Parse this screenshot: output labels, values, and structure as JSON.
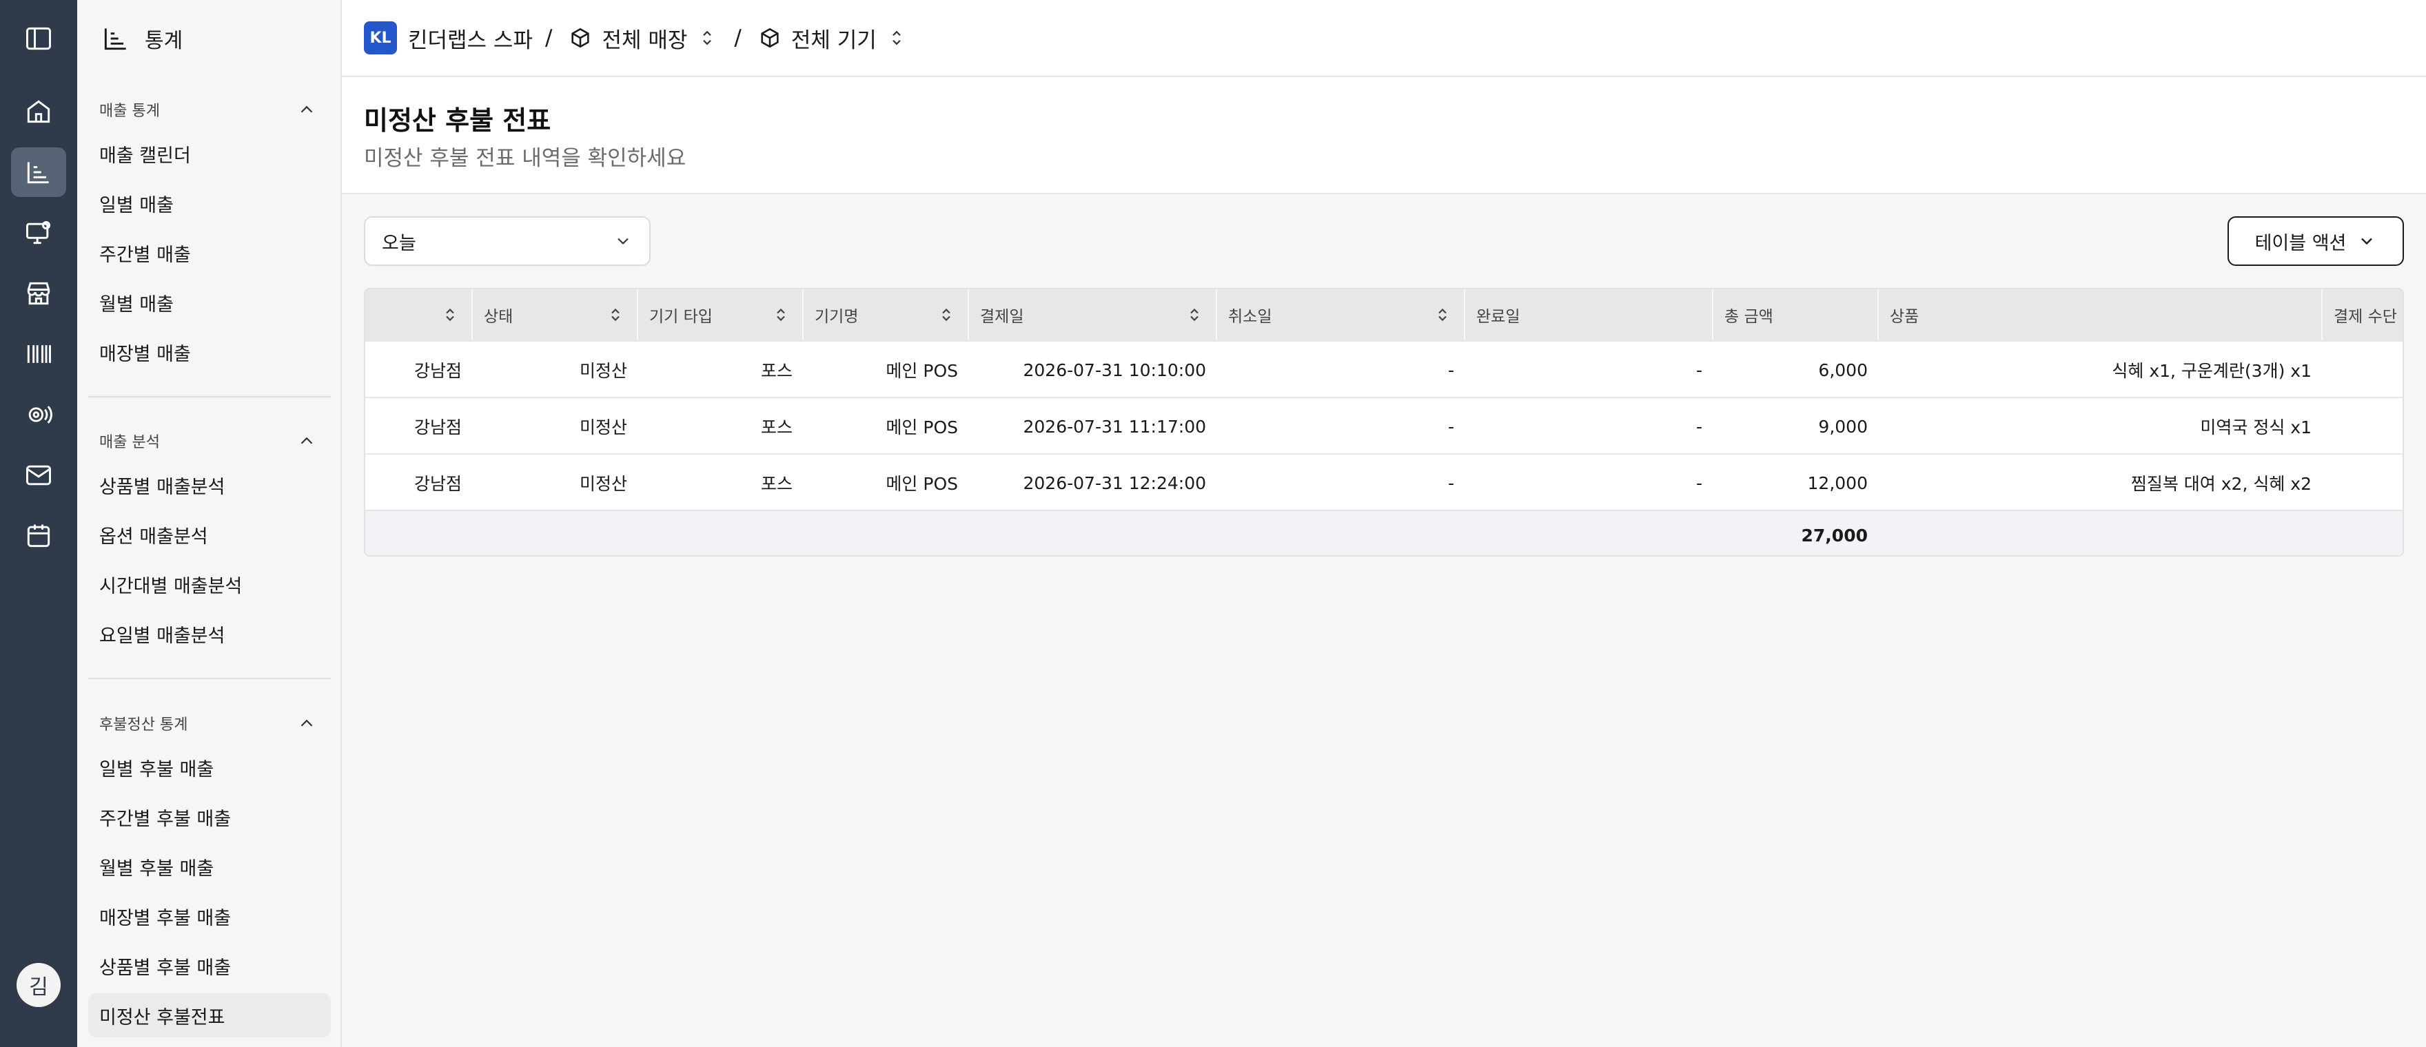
{
  "rail": {
    "avatar_initial": "김",
    "icons": [
      "sidebar-toggle-icon",
      "home-icon",
      "chart-icon",
      "monitor-settings-icon",
      "store-icon",
      "barcode-icon",
      "broadcast-icon",
      "mail-icon",
      "calendar-icon"
    ],
    "active_index": 2
  },
  "sidebar": {
    "title": "통계",
    "sections": [
      {
        "label": "매출 통계",
        "items": [
          "매출 캘린더",
          "일별 매출",
          "주간별 매출",
          "월별 매출",
          "매장별 매출"
        ]
      },
      {
        "label": "매출 분석",
        "items": [
          "상품별 매출분석",
          "옵션 매출분석",
          "시간대별 매출분석",
          "요일별 매출분석"
        ]
      },
      {
        "label": "후불정산 통계",
        "items": [
          "일별 후불 매출",
          "주간별 후불 매출",
          "월별 후불 매출",
          "매장별 후불 매출",
          "상품별 후불 매출",
          "미정산 후불전표"
        ]
      }
    ],
    "active_item": "미정산 후불전표"
  },
  "topbar": {
    "org_badge": "KL",
    "org_name": "킨더랩스 스파",
    "separator": "/",
    "store_selector": "전체 매장",
    "device_selector": "전체 기기"
  },
  "page": {
    "title": "미정산 후불 전표",
    "subtitle": "미정산 후불 전표 내역을 확인하세요"
  },
  "controls": {
    "date_filter": "오늘",
    "table_action": "테이블 액션"
  },
  "table": {
    "columns": [
      "",
      "상태",
      "기기 타입",
      "기기명",
      "결제일",
      "취소일",
      "완료일",
      "총 금액",
      "상품",
      "결제 수단"
    ],
    "rows": [
      [
        "강남점",
        "미정산",
        "포스",
        "메인 POS",
        "2026-07-31 10:10:00",
        "-",
        "-",
        "6,000",
        "식혜 x1, 구운계란(3개) x1",
        ""
      ],
      [
        "강남점",
        "미정산",
        "포스",
        "메인 POS",
        "2026-07-31 11:17:00",
        "-",
        "-",
        "9,000",
        "미역국 정식 x1",
        ""
      ],
      [
        "강남점",
        "미정산",
        "포스",
        "메인 POS",
        "2026-07-31 12:24:00",
        "-",
        "-",
        "12,000",
        "찜질복 대여 x2, 식혜 x2",
        ""
      ]
    ],
    "total_amount": "27,000"
  },
  "colors": {
    "rail_bg": "#2f3b4b",
    "rail_active": "#566375",
    "org_badge": "#2456cc",
    "header_bg": "#e7e7e7",
    "total_row_bg": "#f1f3f6"
  }
}
